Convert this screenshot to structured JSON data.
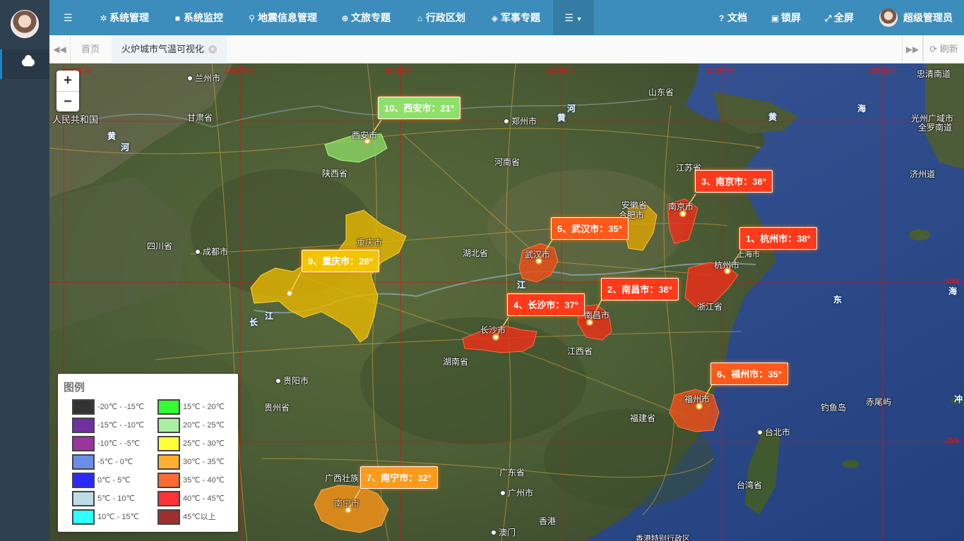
{
  "topbar": {
    "nav": [
      {
        "icon": "gear-icon",
        "glyph": "✲",
        "label": "系统管理"
      },
      {
        "icon": "video-camera-icon",
        "glyph": "■",
        "label": "系统监控"
      },
      {
        "icon": "map-marker-icon",
        "glyph": "⚲",
        "label": "地震信息管理"
      },
      {
        "icon": "globe-icon",
        "glyph": "⊕",
        "label": "文旅专题"
      },
      {
        "icon": "bank-icon",
        "glyph": "⌂",
        "label": "行政区划"
      },
      {
        "icon": "shield-icon",
        "glyph": "◈",
        "label": "军事专题"
      }
    ],
    "right": [
      {
        "icon": "question-circle-icon",
        "glyph": "?",
        "label": "文档"
      },
      {
        "icon": "lock-icon",
        "glyph": "▣",
        "label": "锁屏"
      },
      {
        "icon": "fullscreen-icon",
        "glyph": "⤢",
        "label": "全屏"
      }
    ],
    "user_name": "超级管理员"
  },
  "tabs": {
    "items": [
      {
        "label": "首页"
      },
      {
        "label": "火炉城市气温可视化"
      }
    ],
    "refresh_label": "刷新"
  },
  "map": {
    "grid_labels": [
      "100东经",
      "105东经",
      "110东经",
      "115东经",
      "120东经",
      "125东经",
      "30N",
      "25N"
    ],
    "places": [
      {
        "name": "兰州市",
        "type": "city"
      },
      {
        "name": "甘肃省",
        "type": "province"
      },
      {
        "name": "人民共和国",
        "type": "province"
      },
      {
        "name": "西安市",
        "type": "city"
      },
      {
        "name": "陕西省",
        "type": "province"
      },
      {
        "name": "郑州市",
        "type": "city"
      },
      {
        "name": "河南省",
        "type": "province"
      },
      {
        "name": "山东省",
        "type": "province"
      },
      {
        "name": "江苏省",
        "type": "province"
      },
      {
        "name": "安徽省",
        "type": "province"
      },
      {
        "name": "合肥市",
        "type": "city"
      },
      {
        "name": "南京市",
        "type": "city"
      },
      {
        "name": "上海市",
        "type": "city"
      },
      {
        "name": "杭州市",
        "type": "city"
      },
      {
        "name": "浙江省",
        "type": "province"
      },
      {
        "name": "四川省",
        "type": "province"
      },
      {
        "name": "成都市",
        "type": "city"
      },
      {
        "name": "重庆市",
        "type": "city"
      },
      {
        "name": "湖北省",
        "type": "province"
      },
      {
        "name": "武汉市",
        "type": "city"
      },
      {
        "name": "长沙市",
        "type": "city"
      },
      {
        "name": "湖南省",
        "type": "province"
      },
      {
        "name": "南昌市",
        "type": "city"
      },
      {
        "name": "江西省",
        "type": "province"
      },
      {
        "name": "贵阳市",
        "type": "city"
      },
      {
        "name": "贵州省",
        "type": "province"
      },
      {
        "name": "福建省",
        "type": "province"
      },
      {
        "name": "福州市",
        "type": "city"
      },
      {
        "name": "广西壮族",
        "type": "province"
      },
      {
        "name": "南宁市",
        "type": "city"
      },
      {
        "name": "广东省",
        "type": "province"
      },
      {
        "name": "广州市",
        "type": "city"
      },
      {
        "name": "澳门",
        "type": "city"
      },
      {
        "name": "香港",
        "type": "city"
      },
      {
        "name": "香港特别行政区",
        "type": "province"
      },
      {
        "name": "台北市",
        "type": "city"
      },
      {
        "name": "台湾省",
        "type": "province"
      },
      {
        "name": "钓鱼岛",
        "type": "province"
      },
      {
        "name": "赤尾屿",
        "type": "province"
      },
      {
        "name": "济州道",
        "type": "province"
      },
      {
        "name": "忠清南道",
        "type": "province"
      },
      {
        "name": "光州广域市",
        "type": "province"
      },
      {
        "name": "全罗南道",
        "type": "province"
      },
      {
        "name": "黄",
        "type": "water"
      },
      {
        "name": "河",
        "type": "water"
      },
      {
        "name": "黄",
        "type": "water"
      },
      {
        "name": "河",
        "type": "water"
      },
      {
        "name": "黄",
        "type": "water"
      },
      {
        "name": "海",
        "type": "water"
      },
      {
        "name": "东",
        "type": "water"
      },
      {
        "name": "海",
        "type": "water"
      },
      {
        "name": "长",
        "type": "water"
      },
      {
        "name": "江",
        "type": "water"
      },
      {
        "name": "江",
        "type": "water"
      },
      {
        "name": "冲",
        "type": "water"
      }
    ],
    "rank_labels": [
      {
        "text": "1、杭州市：38°",
        "color": "#ff3a1a"
      },
      {
        "text": "2、南昌市：38°",
        "color": "#ff3a1a"
      },
      {
        "text": "3、南京市：38°",
        "color": "#ff3a1a"
      },
      {
        "text": "4、长沙市：37°",
        "color": "#ff3a1a"
      },
      {
        "text": "5、武汉市：35°",
        "color": "#ff5a1a"
      },
      {
        "text": "6、福州市：35°",
        "color": "#ff5a1a"
      },
      {
        "text": "7、南宁市：32°",
        "color": "#ff9a1a"
      },
      {
        "text": "9、重庆市：28°",
        "color": "#f5c400"
      },
      {
        "text": "10、西安市：21°",
        "color": "#8fe06a"
      }
    ]
  },
  "legend": {
    "title": "图例",
    "items": [
      {
        "label": "-20℃ - -15℃",
        "color": "#333333"
      },
      {
        "label": "-15℃ - -10℃",
        "color": "#7030a0"
      },
      {
        "label": "-10℃ - -5℃",
        "color": "#9a359e"
      },
      {
        "label": "-5℃ - 0℃",
        "color": "#6a8de8"
      },
      {
        "label": "0℃ - 5℃",
        "color": "#2a2aff"
      },
      {
        "label": "5℃ - 10℃",
        "color": "#bcdce6"
      },
      {
        "label": "10℃ - 15℃",
        "color": "#2fffff"
      },
      {
        "label": "15℃ - 20℃",
        "color": "#33ff33"
      },
      {
        "label": "20℃ - 25℃",
        "color": "#a8f0a0"
      },
      {
        "label": "25℃ - 30℃",
        "color": "#ffff33"
      },
      {
        "label": "30℃ - 35℃",
        "color": "#ffb030"
      },
      {
        "label": "35℃ - 40℃",
        "color": "#ff6a33"
      },
      {
        "label": "40℃ - 45℃",
        "color": "#ff3333"
      },
      {
        "label": "45℃以上",
        "color": "#9c3030"
      }
    ]
  }
}
